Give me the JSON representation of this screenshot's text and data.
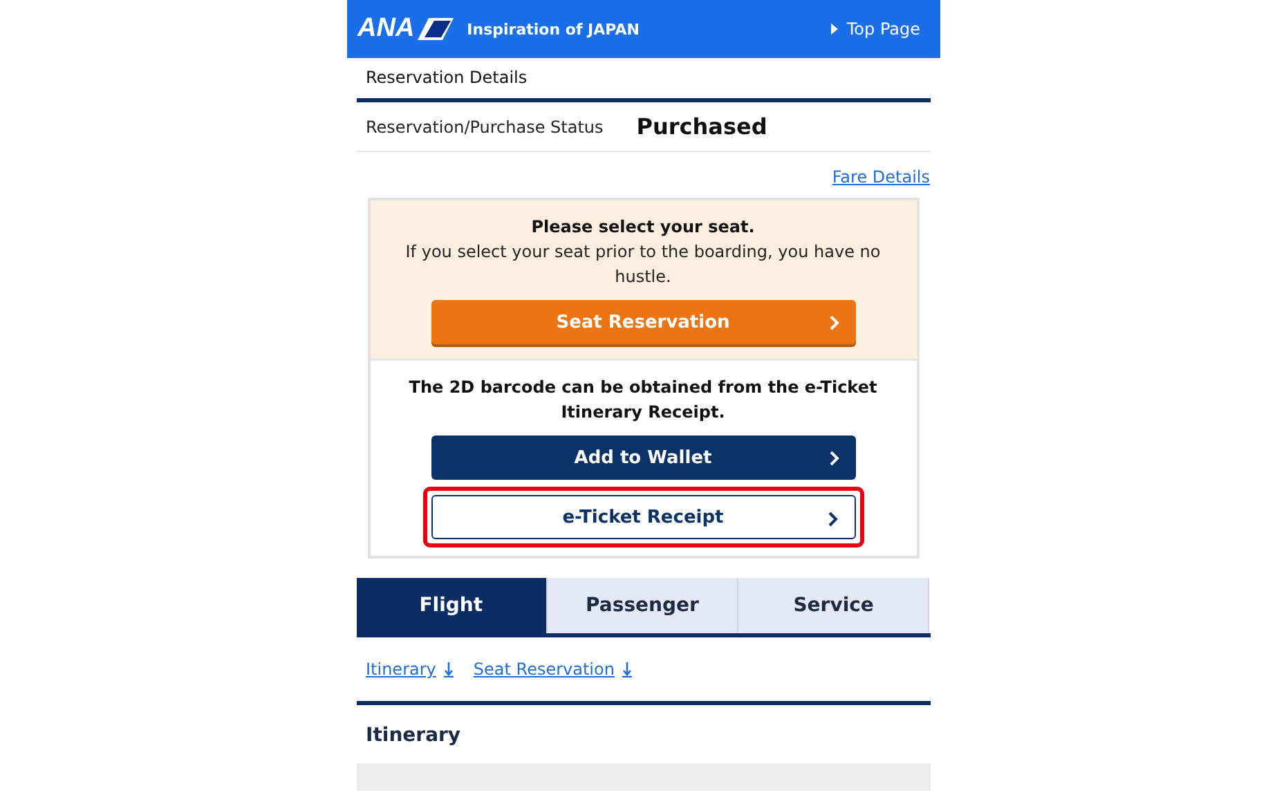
{
  "header": {
    "logo": "ANA",
    "tagline": "Inspiration of JAPAN",
    "link": "Top Page"
  },
  "section_title": "Reservation Details",
  "status": {
    "label": "Reservation/Purchase Status",
    "value": "Purchased"
  },
  "fare_link": "Fare Details",
  "seat_notice": {
    "title": "Please select your seat.",
    "text": "If you select your seat prior to the boarding, you have no hustle.",
    "button": "Seat Reservation"
  },
  "barcode_notice": {
    "text": "The 2D barcode can be obtained from the e-Ticket Itinerary Receipt.",
    "buttons": [
      {
        "label": "Add to Wallet",
        "kind": "filled",
        "highlighted": false
      },
      {
        "label": "e-Ticket Receipt",
        "kind": "outline",
        "highlighted": true
      }
    ]
  },
  "tabs": [
    {
      "label": "Flight",
      "selected": true
    },
    {
      "label": "Passenger",
      "selected": false
    },
    {
      "label": "Service",
      "selected": false
    }
  ],
  "anchors": [
    "Itinerary",
    "Seat Reservation"
  ],
  "itinerary_title": "Itinerary"
}
